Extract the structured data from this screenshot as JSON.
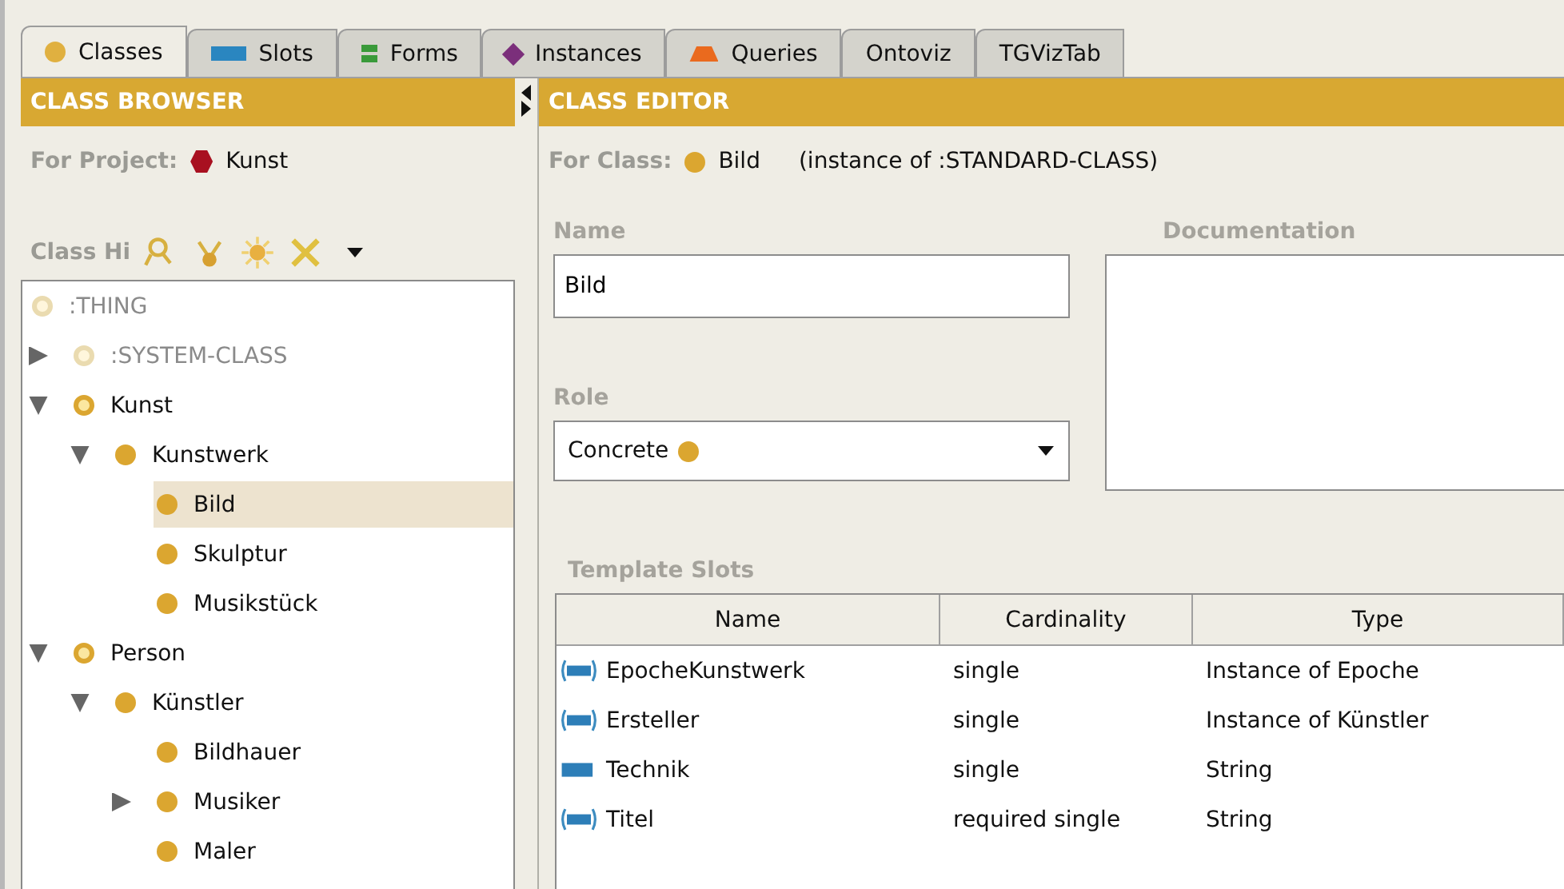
{
  "tabs": [
    {
      "label": "Classes",
      "kind": "circle",
      "selected": true
    },
    {
      "label": "Slots",
      "kind": "bar",
      "selected": false
    },
    {
      "label": "Forms",
      "kind": "forms",
      "selected": false
    },
    {
      "label": "Instances",
      "kind": "diamond",
      "selected": false
    },
    {
      "label": "Queries",
      "kind": "trapezoid",
      "selected": false
    },
    {
      "label": "Ontoviz",
      "kind": "none",
      "selected": false
    },
    {
      "label": "TGVizTab",
      "kind": "none",
      "selected": false
    }
  ],
  "class_browser": {
    "title": "CLASS BROWSER",
    "project_label": "For Project:",
    "project": "Kunst",
    "hierarchy_label": "Class Hi",
    "tree": [
      {
        "label": ":THING",
        "kind": "system",
        "selected": false
      },
      {
        "label": ":SYSTEM-CLASS",
        "kind": "system",
        "selected": false,
        "expanded": false
      },
      {
        "label": "Kunst",
        "kind": "abstract",
        "selected": false,
        "expanded": true,
        "children": [
          {
            "label": "Kunstwerk",
            "kind": "concrete",
            "selected": false,
            "expanded": true,
            "children": [
              {
                "label": "Bild",
                "kind": "concrete",
                "selected": true
              },
              {
                "label": "Skulptur",
                "kind": "concrete",
                "selected": false
              },
              {
                "label": "Musikstück",
                "kind": "concrete",
                "selected": false
              }
            ]
          }
        ]
      },
      {
        "label": "Person",
        "kind": "abstract",
        "selected": false,
        "expanded": true,
        "children": [
          {
            "label": "Künstler",
            "kind": "concrete",
            "selected": false,
            "expanded": true,
            "children": [
              {
                "label": "Bildhauer",
                "kind": "concrete",
                "selected": false
              },
              {
                "label": "Musiker",
                "kind": "concrete",
                "selected": false,
                "expanded": false
              },
              {
                "label": "Maler",
                "kind": "concrete",
                "selected": false
              }
            ]
          }
        ]
      }
    ]
  },
  "class_editor": {
    "title": "CLASS EDITOR",
    "class_label": "For Class:",
    "class_name": "Bild",
    "instance_of": "(instance of :STANDARD-CLASS)",
    "name_label": "Name",
    "name_value": "Bild",
    "documentation_label": "Documentation",
    "role_label": "Role",
    "role_value": "Concrete",
    "slots_label": "Template Slots",
    "table": {
      "columns": [
        "Name",
        "Cardinality",
        "Type"
      ],
      "rows": [
        {
          "kind": "multiple",
          "cells": [
            "EpocheKunstwerk",
            "single",
            "Instance of Epoche"
          ]
        },
        {
          "kind": "multiple",
          "cells": [
            "Ersteller",
            "single",
            "Instance of Künstler"
          ]
        },
        {
          "kind": "single",
          "cells": [
            "Technik",
            "single",
            "String"
          ]
        },
        {
          "kind": "multiple",
          "cells": [
            "Titel",
            "required single",
            "String"
          ]
        }
      ]
    }
  }
}
